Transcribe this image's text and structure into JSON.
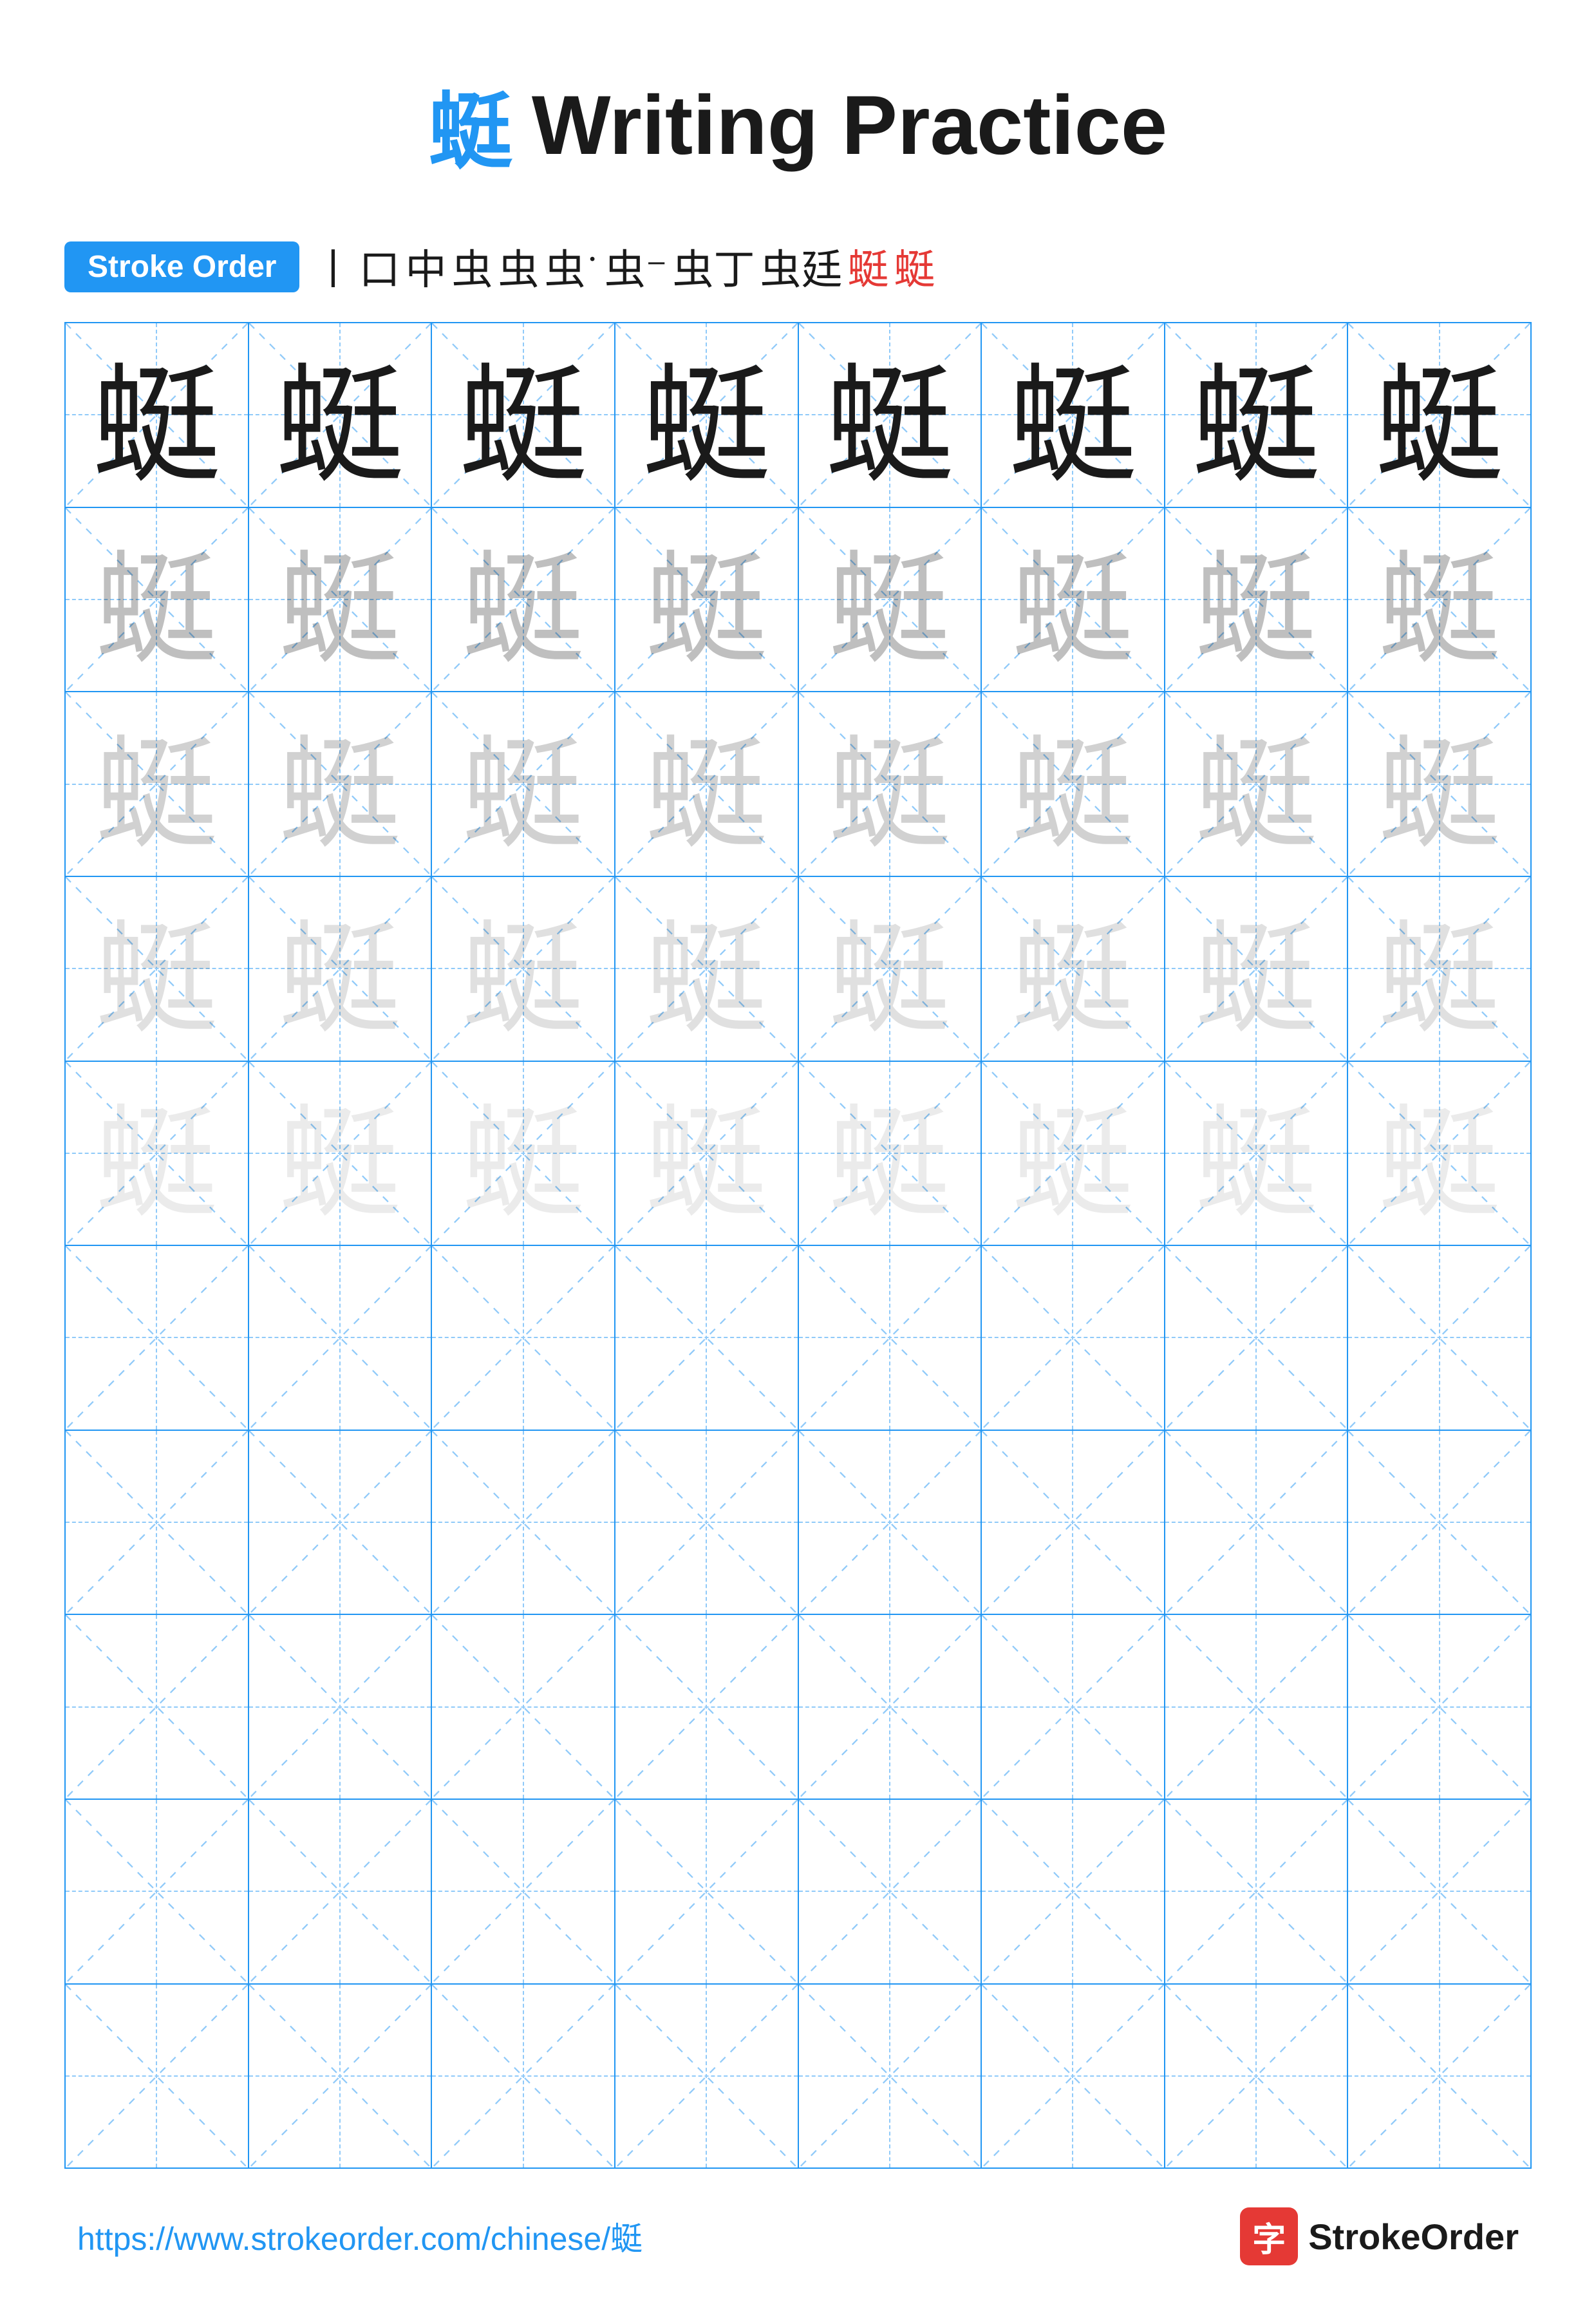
{
  "title": {
    "char": "蜓",
    "text": "Writing Practice"
  },
  "stroke_order": {
    "badge_label": "Stroke Order",
    "steps": [
      "丨",
      "口",
      "中",
      "虫",
      "虫",
      "虫˙",
      "虫⁻",
      "虫丁",
      "虫廷",
      "蜓",
      "蜓"
    ]
  },
  "grid": {
    "rows": 10,
    "cols": 8,
    "char": "蜓",
    "practice_rows": 5,
    "blank_rows": 5
  },
  "footer": {
    "url": "https://www.strokeorder.com/chinese/蜓",
    "brand_char": "字",
    "brand_name": "StrokeOrder"
  }
}
